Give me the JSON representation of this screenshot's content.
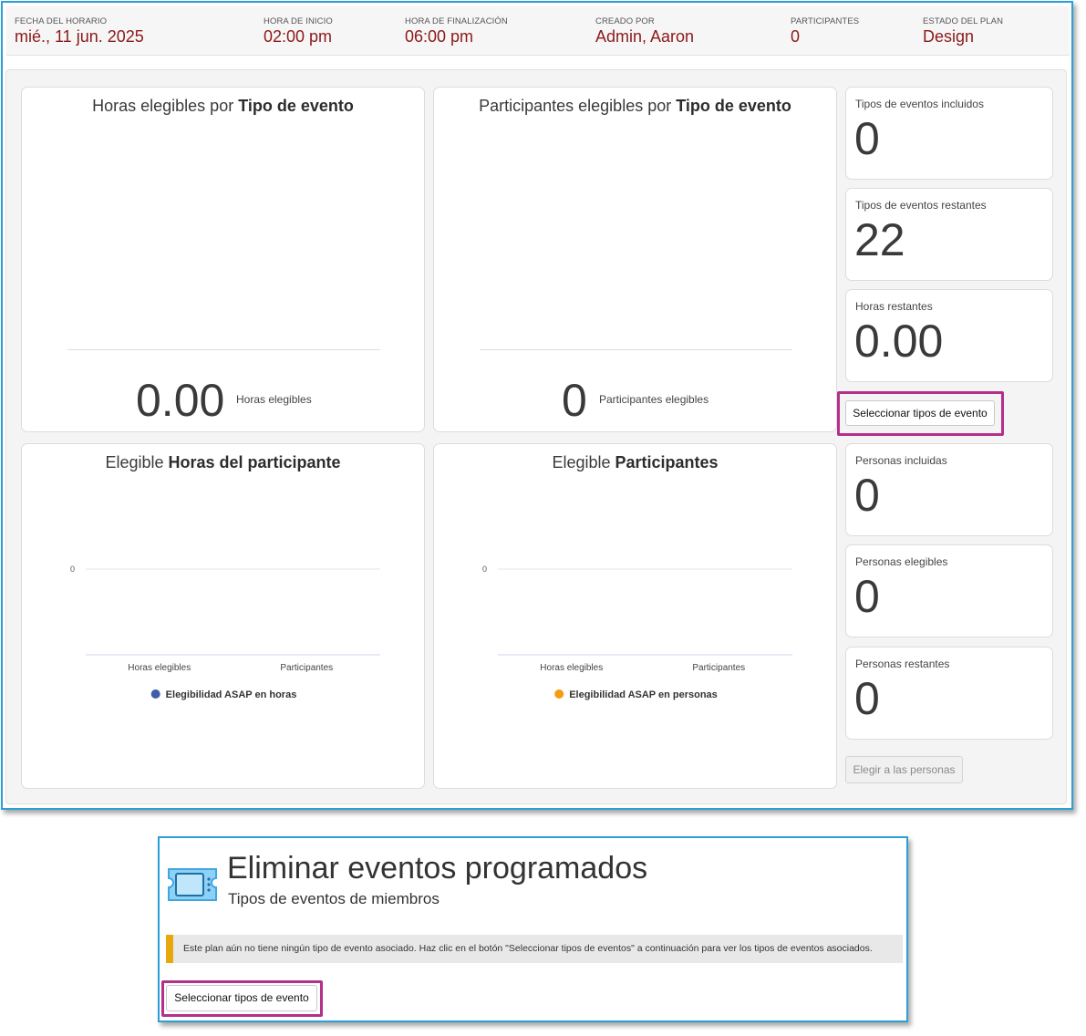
{
  "header": {
    "schedule_date": {
      "label": "FECHA DEL HORARIO",
      "value": "mié., 11 jun. 2025"
    },
    "start_time": {
      "label": "HORA DE INICIO",
      "value": "02:00 pm"
    },
    "end_time": {
      "label": "HORA DE FINALIZACIÓN",
      "value": "06:00 pm"
    },
    "created_by": {
      "label": "CREADO POR",
      "value": "Admin, Aaron"
    },
    "participants": {
      "label": "PARTICIPANTES",
      "value": "0"
    },
    "plan_status": {
      "label": "ESTADO DEL PLAN",
      "value": "Design"
    }
  },
  "cards": {
    "hours_by_type": {
      "title_pre": "Horas elegibles por ",
      "title_bold": "Tipo de evento",
      "value": "0.00",
      "unit": "Horas elegibles"
    },
    "participants_by_type": {
      "title_pre": "Participantes elegibles por ",
      "title_bold": "Tipo de evento",
      "value": "0",
      "unit": "Participantes elegibles"
    },
    "participant_hours": {
      "title_pre": "Elegible ",
      "title_bold": "Horas del participante",
      "legend": "Elegibilidad ASAP en horas"
    },
    "eligible_participants": {
      "title_pre": "Elegible ",
      "title_bold": "Participantes",
      "legend": "Elegibilidad ASAP en personas"
    }
  },
  "stats": {
    "types_included": {
      "label": "Tipos de eventos incluidos",
      "value": "0"
    },
    "types_remaining": {
      "label": "Tipos de eventos restantes",
      "value": "22"
    },
    "hours_remaining": {
      "label": "Horas restantes",
      "value": "0.00"
    },
    "people_included": {
      "label": "Personas incluidas",
      "value": "0"
    },
    "people_eligible": {
      "label": "Personas elegibles",
      "value": "0"
    },
    "people_remaining": {
      "label": "Personas restantes",
      "value": "0"
    }
  },
  "buttons": {
    "select_event_types": "Seleccionar tipos de evento",
    "choose_people": "Elegir a las personas"
  },
  "colors": {
    "hours_series": "#3f5ea8",
    "people_series": "#f59b14",
    "accent_border": "#2b9fd6",
    "highlight": "#b3308c",
    "value_red": "#8b1a1a"
  },
  "chart_data": [
    {
      "type": "bar",
      "categories": [
        "Horas elegibles",
        "Participantes"
      ],
      "series": [
        {
          "name": "Elegibilidad ASAP en horas",
          "values": [
            0,
            0
          ]
        }
      ],
      "title": "Elegible Horas del participante",
      "ylim": [
        0,
        0
      ],
      "yticks": [
        "0"
      ],
      "legend": "bottom"
    },
    {
      "type": "bar",
      "categories": [
        "Horas elegibles",
        "Participantes"
      ],
      "series": [
        {
          "name": "Elegibilidad ASAP en personas",
          "values": [
            0,
            0
          ]
        }
      ],
      "title": "Elegible Participantes",
      "ylim": [
        0,
        0
      ],
      "yticks": [
        "0"
      ],
      "legend": "bottom"
    }
  ],
  "bottom": {
    "icon": "ticket-icon",
    "title": "Eliminar eventos programados",
    "subtitle": "Tipos de eventos de miembros",
    "notice": "Este plan aún no tiene ningún tipo de evento asociado. Haz clic en el botón \"Seleccionar tipos de eventos\" a continuación para ver los tipos de eventos asociados.",
    "button": "Seleccionar tipos de evento"
  }
}
